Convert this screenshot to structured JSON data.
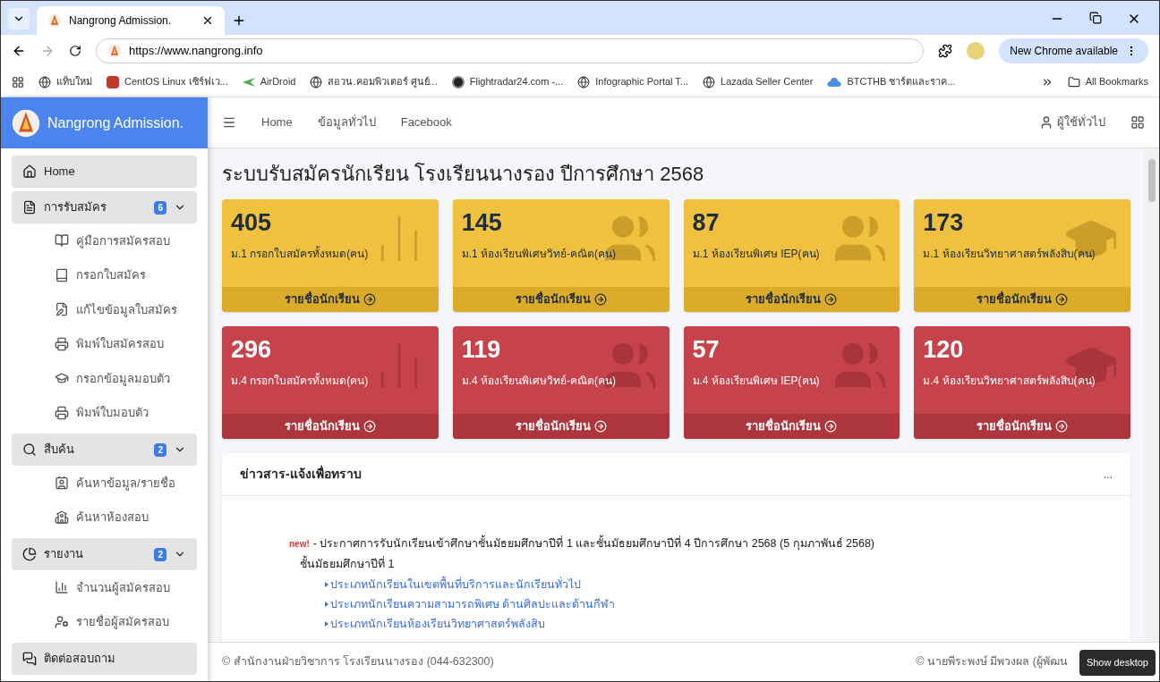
{
  "browser": {
    "tab_title": "Nangrong Admission.",
    "url": "https://www.nangrong.info",
    "update_button": "New Chrome available",
    "bookmarks": [
      "แท็บใหม่",
      "CentOS Linux เซิร์ฟเว...",
      "AirDroid",
      "สอวน.คอมพิวเตอร์ ศูนย์...",
      "Flightradar24.com -...",
      "Infographic Portal T...",
      "Lazada Seller Center",
      "BTCTHB ชาร์ตและราค..."
    ],
    "all_bookmarks": "All Bookmarks"
  },
  "sidebar": {
    "brand": "Nangrong Admission.",
    "items": [
      {
        "label": "Home",
        "kind": "link"
      },
      {
        "label": "การรับสมัคร",
        "kind": "group",
        "badge": "6",
        "expanded": true,
        "children": [
          {
            "label": "คู่มือการสมัครสอบ"
          },
          {
            "label": "กรอกใบสมัคร"
          },
          {
            "label": "แก้ไขข้อมูลใบสมัคร"
          },
          {
            "label": "พิมพ์ใบสมัครสอบ"
          },
          {
            "label": "กรอกข้อมูลมอบตัว"
          },
          {
            "label": "พิมพ์ใบมอบตัว"
          }
        ]
      },
      {
        "label": "สืบค้น",
        "kind": "group",
        "badge": "2",
        "expanded": true,
        "children": [
          {
            "label": "ค้นหาข้อมูล/รายชื่อ"
          },
          {
            "label": "ค้นหาห้องสอบ"
          }
        ]
      },
      {
        "label": "รายงาน",
        "kind": "group",
        "badge": "2",
        "expanded": true,
        "children": [
          {
            "label": "จำนวนผู้สมัครสอบ"
          },
          {
            "label": "รายชื่อผู้สมัครสอบ"
          }
        ]
      },
      {
        "label": "ติดต่อสอบถาม",
        "kind": "link"
      }
    ]
  },
  "navbar": {
    "links": [
      "Home",
      "ข้อมูลทั่วไป",
      "Facebook"
    ],
    "user": "ผู้ใช้ทั่วไป"
  },
  "page_title": "ระบบรับสมัครนักเรียน โรงเรียนนางรอง ปีการศึกษา 2568",
  "card_rows": [
    {
      "kind": "warning",
      "cards": [
        {
          "value": "405",
          "label": "ม.1 กรอกใบสมัครทั้งหมด(คน)",
          "link": "รายชื่อนักเรียน"
        },
        {
          "value": "145",
          "label": "ม.1 ห้องเรียนพิเศษวิทย์-คณิต(คน)",
          "link": "รายชื่อนักเรียน"
        },
        {
          "value": "87",
          "label": "ม.1 ห้องเรียนพิเศษ IEP(คน)",
          "link": "รายชื่อนักเรียน"
        },
        {
          "value": "173",
          "label": "ม.1 ห้องเรียนวิทยาศาสตร์พลังสิบ(คน)",
          "link": "รายชื่อนักเรียน"
        }
      ]
    },
    {
      "kind": "danger",
      "cards": [
        {
          "value": "296",
          "label": "ม.4 กรอกใบสมัครทั้งหมด(คน)",
          "link": "รายชื่อนักเรียน"
        },
        {
          "value": "119",
          "label": "ม.4 ห้องเรียนพิเศษวิทย์-คณิต(คน)",
          "link": "รายชื่อนักเรียน"
        },
        {
          "value": "57",
          "label": "ม.4 ห้องเรียนพิเศษ IEP(คน)",
          "link": "รายชื่อนักเรียน"
        },
        {
          "value": "120",
          "label": "ม.4 ห้องเรียนวิทยาศาสตร์พลังสิบ(คน)",
          "link": "รายชื่อนักเรียน"
        }
      ]
    }
  ],
  "news": {
    "title": "ข่าวสาร-แจ้งเพื่อทราบ",
    "menu": "...",
    "badge": "new!",
    "headline": "- ประกาศการรับนักเรียนเข้าศึกษาชั้นมัธยมศึกษาปีที่ 1 และชั้นมัธยมศึกษาปีที่ 4 ปีการศึกษา 2568 (5 กุมภาพันธ์ 2568)",
    "section": "ชั้นมัธยมศึกษาปีที่ 1",
    "links": [
      "ประเภทนักเรียนในเขตพื้นที่บริการและนักเรียนทั่วไป",
      "ประเภทนักเรียนความสามารถพิเศษ ด้านศิลปะและด้านกีฬา",
      "ประเภทนักเรียนห้องเรียนวิทยาศาสตร์พลังสิบ"
    ]
  },
  "footer": {
    "left": "© สำนักงานฝ่ายวิชาการ โรงเรียนนางรอง (044-632300)",
    "right": "© นายพีระพงษ์ มีพวงผล (ผู้พัฒน"
  },
  "tooltip": "Show desktop"
}
